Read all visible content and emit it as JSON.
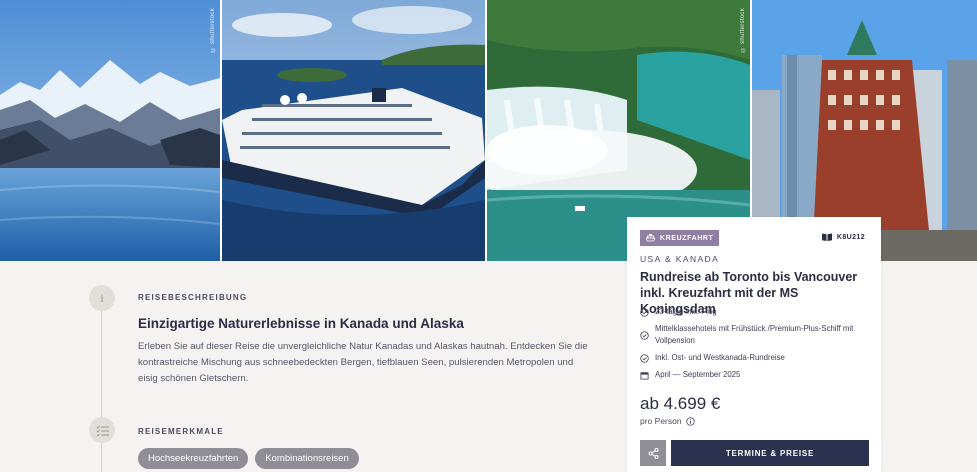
{
  "gallery": {
    "images": [
      {
        "subject": "glacier bay mountains",
        "credit": "© shutterstock"
      },
      {
        "subject": "cruise ship MS Koningsdam"
      },
      {
        "subject": "niagara falls",
        "credit": "© shutterstock"
      },
      {
        "subject": "toronto gooderham building"
      }
    ]
  },
  "description_section": {
    "label": "REISEBESCHREIBUNG",
    "step_icon": "info-icon",
    "headline": "Einzigartige Naturerlebnisse in Kanada und Alaska",
    "text": "Erleben Sie auf dieser Reise die unvergleichliche Natur Kanadas und Alaskas hautnah. Entdecken Sie die kontrastreiche Mischung aus schneebedeckten Bergen, tiefblauen Seen, pulsierenden Metropolen und eisig schönen Gletschern."
  },
  "features_section": {
    "label": "REISEMERKMALE",
    "step_icon": "checklist-icon",
    "tags": [
      "Hochseekreuzfahrten",
      "Kombinationsreisen"
    ]
  },
  "card": {
    "badge": "KREUZFAHRT",
    "badge_icon": "ship-icon",
    "code": "K8U212",
    "code_icon": "catalog-icon",
    "region": "USA & KANADA",
    "title": "Rundreise ab Toronto bis Vancouver inkl. Kreuzfahrt mit der MS Koningsdam",
    "features": [
      {
        "icon": "check-circle-icon",
        "text": "23-tägig inkl. Flug"
      },
      {
        "icon": "check-circle-icon",
        "text": "Mittelklassehotels mit Frühstück /Premium-Plus-Schiff mit Vollpension"
      },
      {
        "icon": "check-circle-icon",
        "text": "Inkl. Ost- und Westkanada-Rundreise"
      },
      {
        "icon": "calendar-icon",
        "text": "April — September 2025"
      }
    ],
    "price": "ab 4.699 €",
    "price_note": "pro Person",
    "price_note_icon": "info-circle-icon",
    "share_icon": "share-icon",
    "cta": "TERMINE & PREISE"
  },
  "colors": {
    "navy": "#2d3150",
    "badge_purple": "#8f7fa3",
    "tag_grey": "#8f8d95",
    "page_bg": "#f4f3f2"
  }
}
